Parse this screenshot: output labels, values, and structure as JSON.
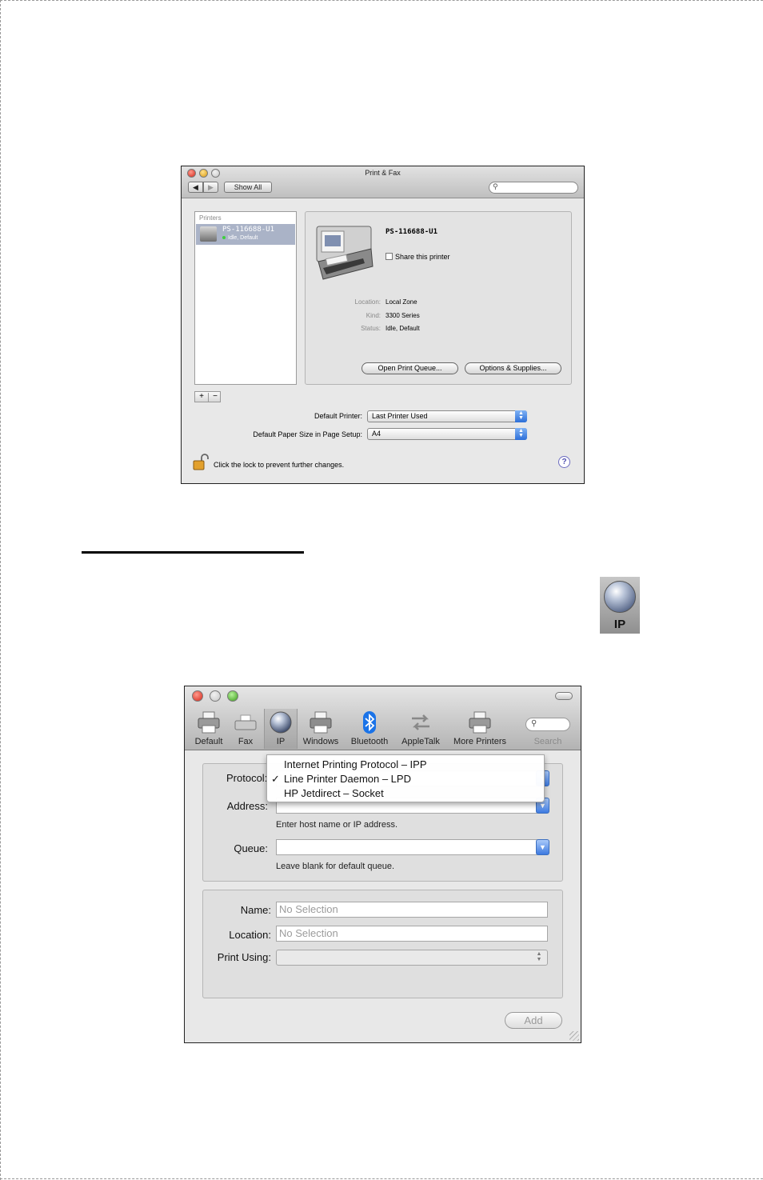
{
  "print_fax": {
    "title": "Print & Fax",
    "nav_back": "◀",
    "nav_forward": "▶",
    "show_all": "Show All",
    "printers_header": "Printers",
    "selected_printer": {
      "name": "PS-116688-U1",
      "status": "Idle, Default"
    },
    "detail": {
      "name": "PS-116688-U1",
      "share_label": "Share this printer",
      "share_checked": false,
      "location_label": "Location:",
      "location_value": "Local Zone",
      "kind_label": "Kind:",
      "kind_value": "3300 Series",
      "status_label": "Status:",
      "status_value": "Idle, Default",
      "open_queue_button": "Open Print Queue...",
      "options_button": "Options & Supplies..."
    },
    "add_button": "+",
    "remove_button": "−",
    "default_printer_label": "Default Printer:",
    "default_printer_value": "Last Printer Used",
    "paper_size_label": "Default Paper Size in Page Setup:",
    "paper_size_value": "A4",
    "lock_text": "Click the lock to prevent further changes.",
    "help": "?"
  },
  "ip_icon": {
    "label": "IP"
  },
  "add_printer": {
    "toolbar": [
      {
        "label": "Default",
        "icon": "printer-icon"
      },
      {
        "label": "Fax",
        "icon": "fax-icon"
      },
      {
        "label": "IP",
        "icon": "globe-icon",
        "selected": true
      },
      {
        "label": "Windows",
        "icon": "windows-printer-icon"
      },
      {
        "label": "Bluetooth",
        "icon": "bluetooth-icon"
      },
      {
        "label": "AppleTalk",
        "icon": "appletalk-icon"
      },
      {
        "label": "More Printers",
        "icon": "printer-icon"
      }
    ],
    "search_label": "Search",
    "protocol_label": "Protocol:",
    "protocol_options": [
      {
        "label": "Internet Printing Protocol – IPP",
        "checked": false
      },
      {
        "label": "Line Printer Daemon – LPD",
        "checked": true
      },
      {
        "label": "HP Jetdirect – Socket",
        "checked": false
      }
    ],
    "checkmark": "✓",
    "address_label": "Address:",
    "address_value": "",
    "address_hint": "Enter host name or IP address.",
    "queue_label": "Queue:",
    "queue_value": "",
    "queue_hint": "Leave blank for default queue.",
    "name_label": "Name:",
    "name_placeholder": "No Selection",
    "location_label": "Location:",
    "location_placeholder": "No Selection",
    "print_using_label": "Print Using:",
    "print_using_value": "",
    "add_button": "Add"
  },
  "colors": {
    "selection_blue": "#3d7ae0",
    "list_selection": "#aab3c7",
    "close_red": "#d3261a"
  }
}
